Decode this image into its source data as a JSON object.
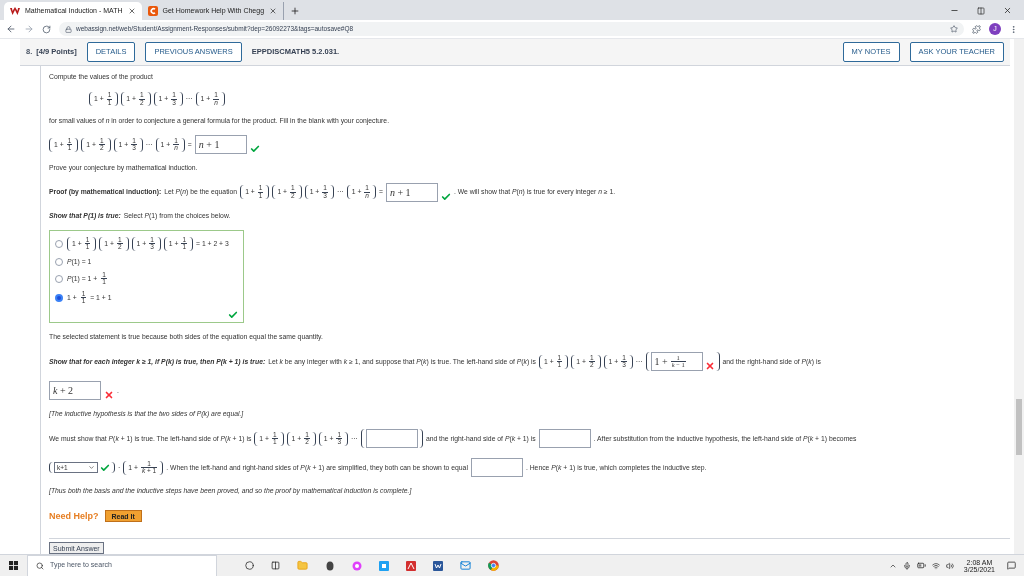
{
  "browser": {
    "tabs": [
      {
        "title": "Mathematical Induction - MATH",
        "selected": true,
        "kind": "webassign"
      },
      {
        "title": "Get Homework Help With Chegg",
        "selected": false,
        "kind": "chegg"
      }
    ],
    "address": "webassign.net/web/Student/Assignment-Responses/submit?dep=26092273&tags=autosave#Q8",
    "profile": "J"
  },
  "question": {
    "number": "8.",
    "points": "[4/9 Points]",
    "buttons": [
      "DETAILS",
      "PREVIOUS ANSWERS"
    ],
    "code": "EPPDISCMATH5 5.2.031.",
    "side_buttons": [
      "MY NOTES",
      "ASK YOUR TEACHER"
    ]
  },
  "paragraphs": [
    {
      "kind": "line",
      "tokens": [
        {
          "kind": "t",
          "text": "Compute the values of the product"
        }
      ]
    },
    {
      "kind": "display",
      "tokens": [
        {
          "kind": "paren",
          "items": [
            {
              "kind": "t",
              "text": "1 +"
            },
            {
              "kind": "frac",
              "num": "1",
              "den": "1"
            }
          ]
        },
        {
          "kind": "paren",
          "items": [
            {
              "kind": "t",
              "text": "1 +"
            },
            {
              "kind": "frac",
              "num": "1",
              "den": "2"
            }
          ]
        },
        {
          "kind": "paren",
          "items": [
            {
              "kind": "t",
              "text": "1 +"
            },
            {
              "kind": "frac",
              "num": "1",
              "den": "3"
            }
          ]
        },
        {
          "kind": "t",
          "text": "···"
        },
        {
          "kind": "paren",
          "items": [
            {
              "kind": "t",
              "text": "1 +"
            },
            {
              "kind": "frac",
              "num": "1",
              "den": "*n*"
            }
          ]
        }
      ]
    },
    {
      "kind": "line",
      "tokens": [
        {
          "kind": "t",
          "text": "for small values of *n* in order to conjecture a general formula for the product. Fill in the blank with your conjecture."
        }
      ]
    },
    {
      "kind": "line",
      "tokens": [
        {
          "kind": "paren",
          "items": [
            {
              "kind": "t",
              "text": "1 +"
            },
            {
              "kind": "frac",
              "num": "1",
              "den": "1"
            }
          ]
        },
        {
          "kind": "paren",
          "items": [
            {
              "kind": "t",
              "text": "1 +"
            },
            {
              "kind": "frac",
              "num": "1",
              "den": "2"
            }
          ]
        },
        {
          "kind": "paren",
          "items": [
            {
              "kind": "t",
              "text": "1 +"
            },
            {
              "kind": "frac",
              "num": "1",
              "den": "3"
            }
          ]
        },
        {
          "kind": "t",
          "text": "···"
        },
        {
          "kind": "paren",
          "items": [
            {
              "kind": "t",
              "text": "1 +"
            },
            {
              "kind": "frac",
              "num": "1",
              "den": "*n*"
            }
          ]
        },
        {
          "kind": "t",
          "text": "="
        },
        {
          "kind": "field",
          "items": [
            {
              "kind": "t",
              "text": "*n* + 1"
            }
          ]
        },
        {
          "kind": "mark",
          "correct": true
        }
      ]
    },
    {
      "kind": "line",
      "tokens": [
        {
          "kind": "t",
          "text": "Prove your conjecture by mathematical induction."
        }
      ]
    },
    {
      "kind": "line",
      "tokens": [
        {
          "kind": "heading",
          "text": "Proof (by mathematical induction):"
        },
        {
          "kind": "t",
          "text": "Let *P*(*n*) be the equation"
        },
        {
          "kind": "paren",
          "items": [
            {
              "kind": "t",
              "text": "1 +"
            },
            {
              "kind": "frac",
              "num": "1",
              "den": "1"
            }
          ]
        },
        {
          "kind": "paren",
          "items": [
            {
              "kind": "t",
              "text": "1 +"
            },
            {
              "kind": "frac",
              "num": "1",
              "den": "2"
            }
          ]
        },
        {
          "kind": "paren",
          "items": [
            {
              "kind": "t",
              "text": "1 +"
            },
            {
              "kind": "frac",
              "num": "1",
              "den": "3"
            }
          ]
        },
        {
          "kind": "t",
          "text": "···"
        },
        {
          "kind": "paren",
          "items": [
            {
              "kind": "t",
              "text": "1 +"
            },
            {
              "kind": "frac",
              "num": "1",
              "den": "*n*"
            }
          ]
        },
        {
          "kind": "t",
          "text": "="
        },
        {
          "kind": "field",
          "items": [
            {
              "kind": "t",
              "text": "*n* + 1"
            }
          ]
        },
        {
          "kind": "mark",
          "correct": true
        },
        {
          "kind": "t",
          "text": ". We will show that *P*(*n*) is true for every integer *n* ≥ 1."
        }
      ]
    },
    {
      "kind": "line",
      "tokens": [
        {
          "kind": "step",
          "text": "Show that P(1) is true:"
        },
        {
          "kind": "t",
          "text": "Select *P*(1) from the choices below."
        }
      ]
    },
    {
      "kind": "choices",
      "correct": true,
      "options": [
        {
          "selected": false,
          "tokens": [
            {
              "kind": "paren",
              "items": [
                {
                  "kind": "t",
                  "text": "1 +"
                },
                {
                  "kind": "frac",
                  "num": "1",
                  "den": "1"
                }
              ]
            },
            {
              "kind": "paren",
              "items": [
                {
                  "kind": "t",
                  "text": "1 +"
                },
                {
                  "kind": "frac",
                  "num": "1",
                  "den": "2"
                }
              ]
            },
            {
              "kind": "paren",
              "items": [
                {
                  "kind": "t",
                  "text": "1 +"
                },
                {
                  "kind": "frac",
                  "num": "1",
                  "den": "3"
                }
              ]
            },
            {
              "kind": "paren",
              "items": [
                {
                  "kind": "t",
                  "text": "1 +"
                },
                {
                  "kind": "frac",
                  "num": "1",
                  "den": "1"
                }
              ]
            },
            {
              "kind": "t",
              "text": "= 1 + 2 + 3"
            }
          ]
        },
        {
          "selected": false,
          "tokens": [
            {
              "kind": "t",
              "text": "*P*(1) = 1"
            }
          ]
        },
        {
          "selected": false,
          "tokens": [
            {
              "kind": "t",
              "text": "*P*(1) = 1 +"
            },
            {
              "kind": "frac",
              "num": "1",
              "den": "1"
            }
          ]
        },
        {
          "selected": true,
          "tokens": [
            {
              "kind": "t",
              "text": "1 +"
            },
            {
              "kind": "frac",
              "num": "1",
              "den": "1"
            },
            {
              "kind": "t",
              "text": "= 1 + 1"
            }
          ]
        }
      ]
    },
    {
      "kind": "line",
      "tokens": [
        {
          "kind": "t",
          "text": "The selected statement is true because both sides of the equation equal the same quantity."
        }
      ]
    },
    {
      "kind": "line",
      "tokens": [
        {
          "kind": "step",
          "text": "Show that for each integer k ≥ 1, if P(k) is true, then P(k + 1) is true:"
        },
        {
          "kind": "t",
          "text": "Let *k* be any integer with *k* ≥ 1, and suppose that *P*(*k*) is true. The left-hand side of *P*(*k*) is"
        },
        {
          "kind": "paren",
          "items": [
            {
              "kind": "t",
              "text": "1 +"
            },
            {
              "kind": "frac",
              "num": "1",
              "den": "1"
            }
          ]
        },
        {
          "kind": "paren",
          "items": [
            {
              "kind": "t",
              "text": "1 +"
            },
            {
              "kind": "frac",
              "num": "1",
              "den": "2"
            }
          ]
        },
        {
          "kind": "paren",
          "items": [
            {
              "kind": "t",
              "text": "1 +"
            },
            {
              "kind": "frac",
              "num": "1",
              "den": "3"
            }
          ]
        },
        {
          "kind": "t",
          "text": "···"
        },
        {
          "kind": "paren",
          "items": [
            {
              "kind": "field",
              "items": [
                {
                  "kind": "t",
                  "text": "1 +"
                },
                {
                  "kind": "frac",
                  "num": "1",
                  "den": "*k* − 1"
                }
              ]
            },
            {
              "kind": "mark",
              "correct": false
            }
          ]
        },
        {
          "kind": "t",
          "text": "and the right-hand side of *P*(*k*) is"
        }
      ]
    },
    {
      "kind": "line",
      "tokens": [
        {
          "kind": "field",
          "items": [
            {
              "kind": "t",
              "text": "*k* + 2"
            }
          ]
        },
        {
          "kind": "mark",
          "correct": false
        },
        {
          "kind": "t",
          "text": "."
        }
      ]
    },
    {
      "kind": "line",
      "tokens": [
        {
          "kind": "note",
          "text": "[The inductive hypothesis is that the two sides of *P*(*k*) are equal.]"
        }
      ]
    },
    {
      "kind": "line",
      "tokens": [
        {
          "kind": "t",
          "text": "We must show that *P*(*k* + 1) is true. The left-hand side of *P*(*k* + 1) is"
        },
        {
          "kind": "paren",
          "items": [
            {
              "kind": "t",
              "text": "1 +"
            },
            {
              "kind": "frac",
              "num": "1",
              "den": "1"
            }
          ]
        },
        {
          "kind": "paren",
          "items": [
            {
              "kind": "t",
              "text": "1 +"
            },
            {
              "kind": "frac",
              "num": "1",
              "den": "2"
            }
          ]
        },
        {
          "kind": "paren",
          "items": [
            {
              "kind": "t",
              "text": "1 +"
            },
            {
              "kind": "frac",
              "num": "1",
              "den": "3"
            }
          ]
        },
        {
          "kind": "t",
          "text": "···"
        },
        {
          "kind": "paren",
          "items": [
            {
              "kind": "field"
            }
          ]
        },
        {
          "kind": "t",
          "text": "and the right-hand side of *P*(*k* + 1) is"
        },
        {
          "kind": "field"
        },
        {
          "kind": "t",
          "text": ". After substitution from the inductive hypothesis, the left-hand side of *P*(*k* + 1) becomes"
        }
      ]
    },
    {
      "kind": "line",
      "tokens": [
        {
          "kind": "paren",
          "items": [
            {
              "kind": "select",
              "value": "k+1"
            },
            {
              "kind": "mark",
              "correct": true
            }
          ]
        },
        {
          "kind": "t",
          "text": "·"
        },
        {
          "kind": "paren",
          "items": [
            {
              "kind": "t",
              "text": "1 +"
            },
            {
              "kind": "frac",
              "num": "1",
              "den": "*k* + 1"
            }
          ]
        },
        {
          "kind": "t",
          "text": ". When the left-hand and right-hand sides of *P*(*k* + 1) are simplified, they both can be shown to equal"
        },
        {
          "kind": "field"
        },
        {
          "kind": "t",
          "text": ". Hence *P*(*k* + 1) is true, which completes the inductive step."
        }
      ]
    },
    {
      "kind": "line",
      "tokens": [
        {
          "kind": "note",
          "text": "[Thus both the basis and the inductive steps have been proved, and so the proof by mathematical induction is complete.]"
        }
      ]
    }
  ],
  "help": {
    "label": "Need Help?",
    "button": "Read It"
  },
  "submit": "Submit Answer",
  "taskbar": {
    "search_placeholder": "Type here to search",
    "time": "2:08 AM",
    "date": "3/25/2021"
  }
}
